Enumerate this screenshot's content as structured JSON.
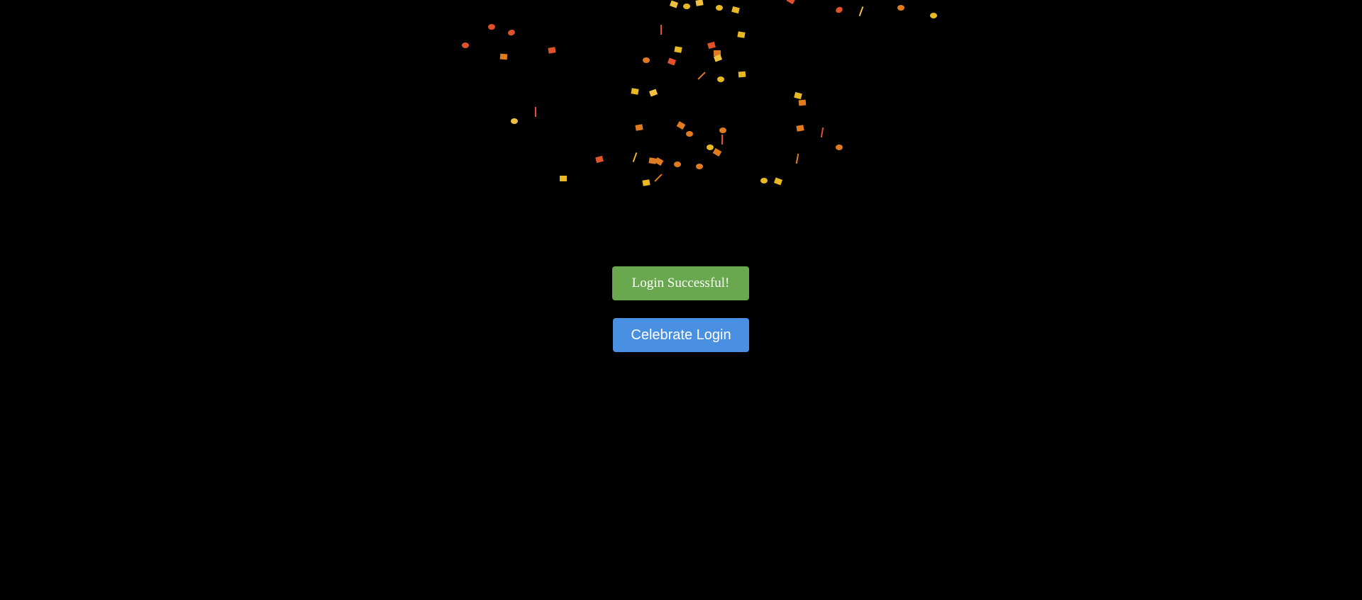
{
  "status_message": "Login Successful!",
  "celebrate_button_label": "Celebrate Login",
  "colors": {
    "background": "#000000",
    "status_banner": "#6aa84f",
    "celebrate_button": "#4a90e2",
    "confetti_palette": [
      "#e8b923",
      "#f0c040",
      "#e07b20",
      "#e0522a",
      "#d4a017"
    ]
  },
  "confetti": {
    "visible": true,
    "shapes": [
      "circle",
      "rectangle",
      "streamer"
    ]
  }
}
